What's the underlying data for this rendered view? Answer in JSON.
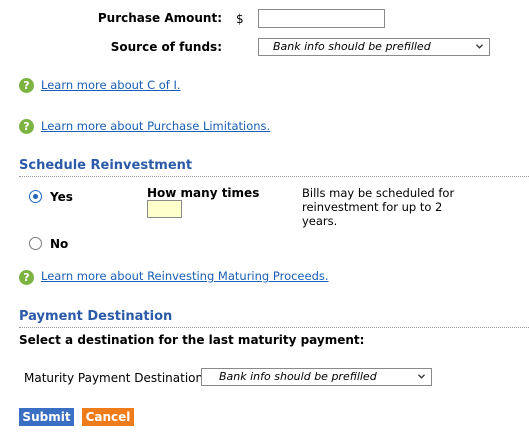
{
  "purchase": {
    "amount_label": "Purchase Amount:",
    "currency_symbol": "$",
    "amount_value": "",
    "source_label": "Source of funds:",
    "source_selected": "Bank info should be prefilled"
  },
  "help_links": {
    "c_of_i": "Learn more about C of I.",
    "purchase_limitations": "Learn more about Purchase Limitations.",
    "reinvesting": "Learn more about Reinvesting Maturing Proceeds."
  },
  "reinvestment": {
    "title": "Schedule Reinvestment",
    "yes_label": "Yes",
    "no_label": "No",
    "selected": "Yes",
    "how_many_label": "How many times",
    "how_many_value": "",
    "info_text": "Bills may be scheduled for reinvestment for up to 2 years."
  },
  "payment": {
    "title": "Payment Destination",
    "instruction": "Select a destination for the last maturity payment:",
    "destination_label": "Maturity Payment Destination:",
    "destination_selected": "Bank info should be prefilled"
  },
  "buttons": {
    "submit": "Submit",
    "cancel": "Cancel"
  },
  "colors": {
    "section_title": "#2b5ba8",
    "link": "#1a5fb4",
    "help_icon": "#7cb342",
    "submit": "#3a6fc4",
    "cancel": "#f07b1a",
    "input_highlight": "#ffffcc"
  },
  "icons": {
    "help": "question-circle-icon",
    "dropdown": "chevron-down-icon"
  }
}
